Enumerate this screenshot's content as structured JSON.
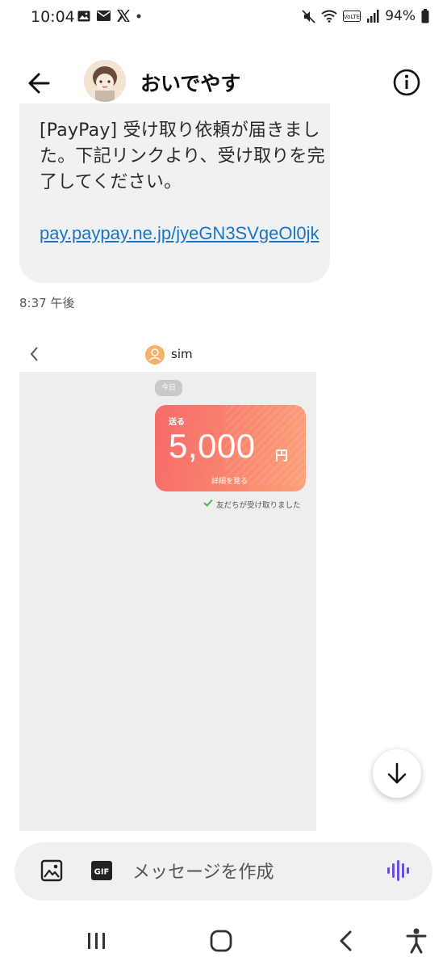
{
  "status_bar": {
    "time": "10:04",
    "battery": "94%",
    "icons": [
      "gallery-icon",
      "mail-icon",
      "x-logo-icon",
      "dot-icon",
      "mute-icon",
      "wifi-icon",
      "volte-icon",
      "signal-icon",
      "battery-icon"
    ]
  },
  "header": {
    "contact_name": "おいでやす",
    "icons": [
      "back-arrow-icon",
      "avatar",
      "info-icon"
    ]
  },
  "message": {
    "text": "[PayPay] 受け取り依頼が届きました。下記リンクより、受け取りを完了してください。",
    "link": "pay.paypay.ne.jp/jyeGN3SVgeOl0jk",
    "time": "8:37 午後"
  },
  "attachment": {
    "chat_name": "sim",
    "date_pill": "今日",
    "card_label": "送る",
    "amount": "5,000",
    "currency": "円",
    "detail_link": "詳細を見る",
    "status": "友だちが受け取りました",
    "colors": {
      "card_start": "#f76a6a",
      "card_end": "#fba27a",
      "check": "#4caf50"
    }
  },
  "composer": {
    "placeholder": "メッセージを作成",
    "icons": [
      "image-icon",
      "gif-icon",
      "voice-icon"
    ]
  },
  "nav": {
    "icons": [
      "recents-icon",
      "home-icon",
      "back-icon",
      "accessibility-icon"
    ]
  },
  "colors": {
    "link": "#1a74c8",
    "voice_accent": "#6b4fd8",
    "bubble_bg": "#f0f1f2"
  }
}
